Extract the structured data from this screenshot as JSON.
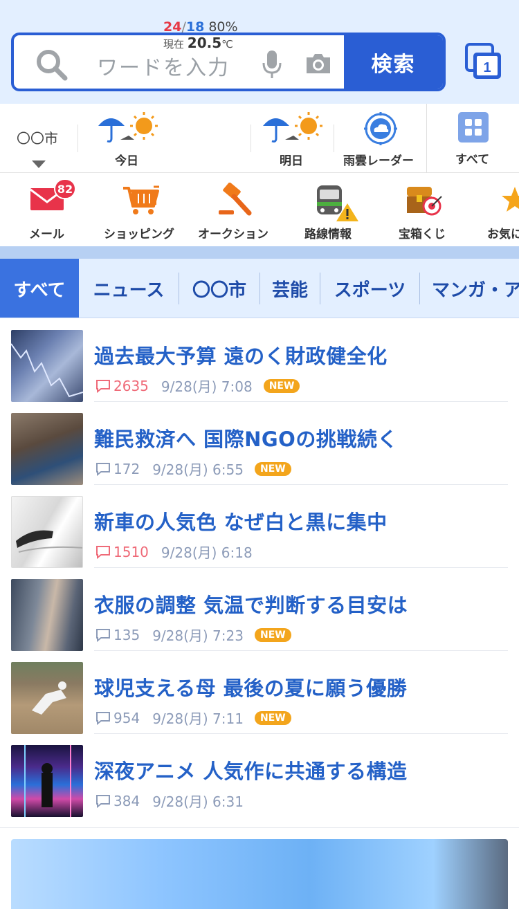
{
  "search": {
    "placeholder": "ワードを入力",
    "button_label": "検索",
    "tab_count": "1"
  },
  "weather": {
    "city": "〇〇市",
    "today_label": "今日",
    "tomorrow_label": "明日",
    "temp_high": "24",
    "temp_low": "18",
    "separator": "/",
    "rain_chance": "80%",
    "now_label": "現在",
    "now_value": "20.5",
    "now_unit": "℃",
    "radar_label": "雨雲レーダー",
    "all_label": "すべて"
  },
  "services": {
    "mail": "メール",
    "mail_badge": "82",
    "shopping": "ショッピング",
    "auction": "オークション",
    "transit": "路線情報",
    "lottery": "宝箱くじ",
    "favorites": "お気に"
  },
  "categories": [
    "すべて",
    "ニュース",
    "〇〇市",
    "芸能",
    "スポーツ",
    "マンガ・ア"
  ],
  "news": [
    {
      "title": "過去最大予算 遠のく財政健全化",
      "comments": "2635",
      "time": "9/28(月) 7:08",
      "new": "NEW"
    },
    {
      "title": "難民救済へ 国際NGOの挑戦続く",
      "comments": "172",
      "time": "9/28(月) 6:55",
      "new": "NEW"
    },
    {
      "title": "新車の人気色 なぜ白と黒に集中",
      "comments": "1510",
      "time": "9/28(月) 6:18"
    },
    {
      "title": "衣服の調整 気温で判断する目安は",
      "comments": "135",
      "time": "9/28(月) 7:23",
      "new": "NEW"
    },
    {
      "title": "球児支える母 最後の夏に願う優勝",
      "comments": "954",
      "time": "9/28(月) 7:11",
      "new": "NEW"
    },
    {
      "title": "深夜アニメ 人気作に共通する構造",
      "comments": "384",
      "time": "9/28(月) 6:31"
    }
  ],
  "colors": {
    "accent": "#2a5ed4",
    "headline": "#2461c7",
    "hot_count": "#ef6a78",
    "new_badge": "#f3a51c"
  }
}
